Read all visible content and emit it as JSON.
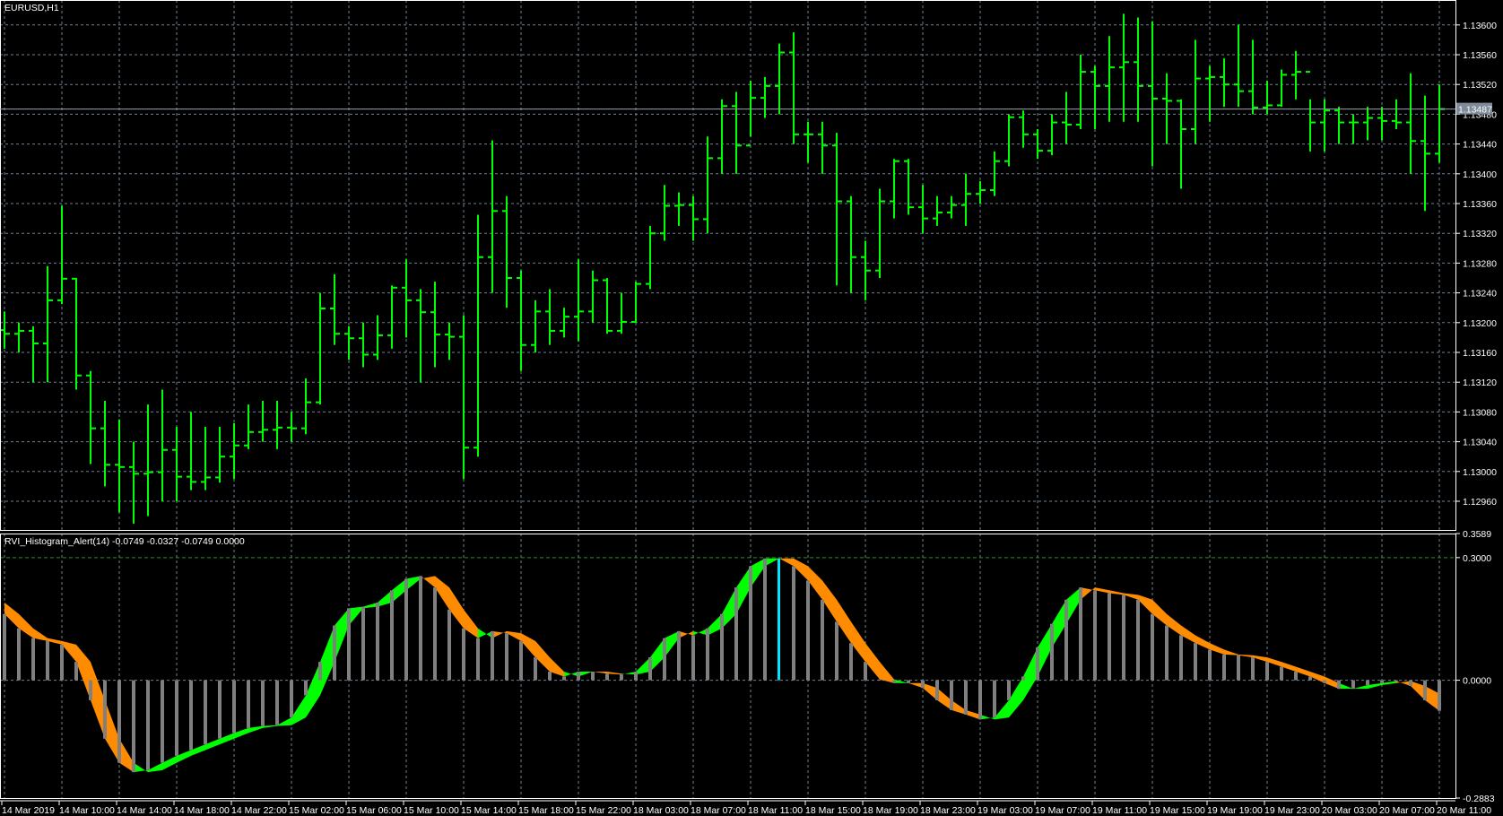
{
  "window": {
    "symbol_label": "EURUSD,H1"
  },
  "indicator": {
    "label": "RVI_Histogram_Alert(14) -0.0749 -0.0327 -0.0749 0.0000"
  },
  "colors": {
    "background": "#000000",
    "bars": "#00ff00",
    "grid": "#6f7f91",
    "up_band": "#00ff00",
    "down_band": "#ff8c00",
    "histogram": "#808080",
    "alert_bar": "#00e5ff",
    "level": "#2e8b2e",
    "price_tag": "#7f8b98"
  },
  "chart_data": [
    {
      "type": "ohlc",
      "title": "EURUSD,H1",
      "ylim": [
        1.12935,
        1.13625
      ],
      "yticks": [
        "1.13600",
        "1.13560",
        "1.13520",
        "1.13480",
        "1.13440",
        "1.13400",
        "1.13360",
        "1.13320",
        "1.13280",
        "1.13240",
        "1.13200",
        "1.13160",
        "1.13120",
        "1.13080",
        "1.13040",
        "1.13000",
        "1.12960"
      ],
      "current_price": "1.13487",
      "first_open": 1.1319,
      "close": [
        1.13185,
        1.13189,
        1.13172,
        1.1323,
        1.13259,
        1.13129,
        1.13058,
        1.13009,
        1.13006,
        1.12997,
        1.12999,
        1.13029,
        1.12993,
        1.12986,
        1.12992,
        1.1302,
        1.13035,
        1.13053,
        1.13056,
        1.13059,
        1.13058,
        1.13093,
        1.13219,
        1.13185,
        1.13179,
        1.13157,
        1.13183,
        1.13247,
        1.1323,
        1.13214,
        1.13184,
        1.13181,
        1.13032,
        1.13288,
        1.1335,
        1.1326,
        1.1317,
        1.13215,
        1.13189,
        1.13208,
        1.13215,
        1.13257,
        1.13189,
        1.13201,
        1.13252,
        1.1332,
        1.13357,
        1.13358,
        1.13339,
        1.13421,
        1.13491,
        1.13438,
        1.13502,
        1.13518,
        1.13563,
        1.13453,
        1.13453,
        1.13438,
        1.13363,
        1.13288,
        1.1327,
        1.13363,
        1.13417,
        1.13355,
        1.1334,
        1.13348,
        1.13358,
        1.13373,
        1.13378,
        1.13417,
        1.13476,
        1.13453,
        1.13431,
        1.13469,
        1.13466,
        1.13537,
        1.13518,
        1.13543,
        1.1355,
        1.13518,
        1.13501,
        1.13498,
        1.1346,
        1.13528,
        1.1353,
        1.1352,
        1.13511,
        1.13489,
        1.13492,
        1.13533,
        1.13537,
        1.13469,
        1.13485,
        1.13469,
        1.13469,
        1.13475,
        1.13471,
        1.13469,
        1.13444,
        1.13427,
        1.13487
      ],
      "high": [
        1.13215,
        1.132,
        1.13195,
        1.13276,
        1.13357,
        1.1326,
        1.13135,
        1.13095,
        1.1307,
        1.1304,
        1.1309,
        1.1311,
        1.1306,
        1.1308,
        1.1306,
        1.1306,
        1.13065,
        1.1309,
        1.13095,
        1.13095,
        1.1308,
        1.13125,
        1.1324,
        1.13265,
        1.13195,
        1.132,
        1.1321,
        1.1325,
        1.13285,
        1.13245,
        1.13255,
        1.132,
        1.1321,
        1.13345,
        1.13445,
        1.1337,
        1.1327,
        1.1323,
        1.13245,
        1.1322,
        1.13285,
        1.1327,
        1.1326,
        1.1324,
        1.13255,
        1.1333,
        1.13385,
        1.13375,
        1.1337,
        1.1345,
        1.135,
        1.1351,
        1.13525,
        1.1353,
        1.13575,
        1.1359,
        1.1347,
        1.1347,
        1.13455,
        1.1337,
        1.1331,
        1.1338,
        1.1342,
        1.1342,
        1.13385,
        1.1337,
        1.1337,
        1.134,
        1.1339,
        1.1343,
        1.1348,
        1.13485,
        1.1346,
        1.1348,
        1.1351,
        1.1356,
        1.13545,
        1.13585,
        1.13615,
        1.1361,
        1.13605,
        1.13535,
        1.135,
        1.1358,
        1.13545,
        1.13555,
        1.136,
        1.1358,
        1.13525,
        1.1354,
        1.13565,
        1.135,
        1.135,
        1.1349,
        1.1348,
        1.1349,
        1.1349,
        1.135,
        1.13535,
        1.13505,
        1.1352
      ],
      "low": [
        1.13165,
        1.1316,
        1.1312,
        1.1312,
        1.13225,
        1.1311,
        1.1301,
        1.1298,
        1.12945,
        1.1293,
        1.1294,
        1.1296,
        1.1296,
        1.12975,
        1.12975,
        1.12985,
        1.1299,
        1.1303,
        1.1304,
        1.1303,
        1.1304,
        1.1305,
        1.1309,
        1.1317,
        1.1315,
        1.1314,
        1.1315,
        1.13165,
        1.1318,
        1.1312,
        1.1314,
        1.1315,
        1.1299,
        1.1302,
        1.1324,
        1.1322,
        1.13135,
        1.1316,
        1.1317,
        1.1318,
        1.13175,
        1.132,
        1.13185,
        1.13185,
        1.132,
        1.13245,
        1.1331,
        1.1333,
        1.1331,
        1.1332,
        1.134,
        1.134,
        1.1345,
        1.13475,
        1.1348,
        1.1344,
        1.13415,
        1.134,
        1.1325,
        1.1324,
        1.1323,
        1.1326,
        1.1334,
        1.13345,
        1.1332,
        1.1333,
        1.1334,
        1.1333,
        1.1336,
        1.1337,
        1.1341,
        1.13435,
        1.1342,
        1.13425,
        1.1344,
        1.1346,
        1.1346,
        1.1347,
        1.1347,
        1.1347,
        1.1341,
        1.1344,
        1.1338,
        1.1344,
        1.1347,
        1.1349,
        1.1349,
        1.1348,
        1.1348,
        1.1349,
        1.135,
        1.1343,
        1.1343,
        1.1344,
        1.1344,
        1.13445,
        1.13445,
        1.1346,
        1.134,
        1.1335,
        1.13415
      ],
      "xticks": [
        "14 Mar 2019",
        "14 Mar 10:00",
        "14 Mar 14:00",
        "14 Mar 18:00",
        "14 Mar 22:00",
        "15 Mar 02:00",
        "15 Mar 06:00",
        "15 Mar 10:00",
        "15 Mar 14:00",
        "15 Mar 18:00",
        "15 Mar 22:00",
        "18 Mar 03:00",
        "18 Mar 07:00",
        "18 Mar 11:00",
        "18 Mar 15:00",
        "18 Mar 19:00",
        "18 Mar 23:00",
        "19 Mar 03:00",
        "19 Mar 07:00",
        "19 Mar 11:00",
        "19 Mar 15:00",
        "19 Mar 19:00",
        "19 Mar 23:00",
        "20 Mar 03:00",
        "20 Mar 07:00",
        "20 Mar 11:00"
      ],
      "xtick_every_bars": 4
    },
    {
      "type": "histogram",
      "title": "RVI_Histogram_Alert(14)",
      "ylim": [
        -0.2883,
        0.3589
      ],
      "yticks": [
        "0.3589",
        "0.3000",
        "0.0000",
        "-0.2883"
      ],
      "levels": [
        0.3,
        0.0
      ],
      "alert_bar_index": 54,
      "rvi": [
        0.162,
        0.127,
        0.103,
        0.096,
        0.087,
        0.045,
        -0.049,
        -0.143,
        -0.202,
        -0.225,
        -0.22,
        -0.202,
        -0.185,
        -0.171,
        -0.157,
        -0.143,
        -0.129,
        -0.117,
        -0.112,
        -0.11,
        -0.091,
        -0.037,
        0.045,
        0.134,
        0.176,
        0.18,
        0.19,
        0.22,
        0.248,
        0.255,
        0.227,
        0.173,
        0.127,
        0.103,
        0.12,
        0.115,
        0.096,
        0.056,
        0.021,
        0.009,
        0.021,
        0.021,
        0.016,
        0.014,
        0.021,
        0.056,
        0.103,
        0.12,
        0.11,
        0.127,
        0.162,
        0.227,
        0.279,
        0.298,
        0.298,
        0.279,
        0.244,
        0.197,
        0.143,
        0.091,
        0.045,
        0.002,
        -0.007,
        -0.007,
        -0.019,
        -0.049,
        -0.073,
        -0.084,
        -0.096,
        -0.091,
        -0.049,
        0.009,
        0.08,
        0.138,
        0.197,
        0.227,
        0.22,
        0.213,
        0.209,
        0.197,
        0.162,
        0.134,
        0.11,
        0.091,
        0.075,
        0.063,
        0.061,
        0.056,
        0.045,
        0.033,
        0.021,
        0.009,
        -0.007,
        -0.021,
        -0.021,
        -0.012,
        -0.007,
        -0.002,
        -0.014,
        -0.049,
        -0.0749
      ],
      "signal": [
        0.19,
        0.162,
        0.127,
        0.103,
        0.096,
        0.087,
        0.045,
        -0.049,
        -0.143,
        -0.202,
        -0.225,
        -0.22,
        -0.202,
        -0.185,
        -0.171,
        -0.157,
        -0.143,
        -0.129,
        -0.117,
        -0.112,
        -0.11,
        -0.091,
        -0.037,
        0.045,
        0.134,
        0.176,
        0.18,
        0.19,
        0.22,
        0.248,
        0.255,
        0.227,
        0.173,
        0.127,
        0.103,
        0.12,
        0.115,
        0.096,
        0.056,
        0.021,
        0.009,
        0.021,
        0.021,
        0.016,
        0.014,
        0.021,
        0.056,
        0.103,
        0.12,
        0.11,
        0.127,
        0.162,
        0.227,
        0.279,
        0.298,
        0.298,
        0.279,
        0.244,
        0.197,
        0.143,
        0.091,
        0.045,
        0.002,
        -0.007,
        -0.007,
        -0.019,
        -0.049,
        -0.073,
        -0.084,
        -0.096,
        -0.091,
        -0.049,
        0.009,
        0.08,
        0.138,
        0.197,
        0.227,
        0.22,
        0.213,
        0.209,
        0.197,
        0.162,
        0.134,
        0.11,
        0.091,
        0.075,
        0.063,
        0.061,
        0.056,
        0.045,
        0.033,
        0.021,
        0.009,
        -0.007,
        -0.021,
        -0.021,
        -0.012,
        -0.007,
        -0.002,
        -0.014,
        -0.0327
      ]
    }
  ]
}
